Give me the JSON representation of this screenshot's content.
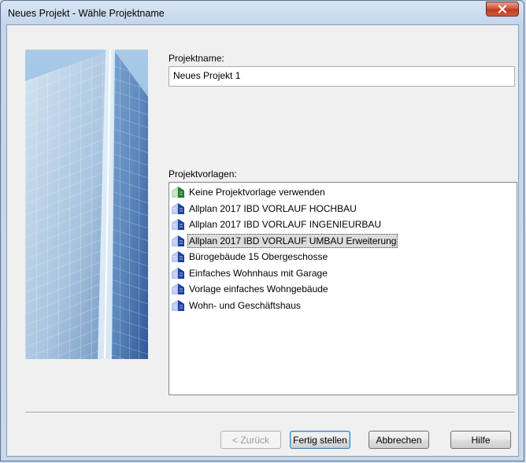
{
  "window": {
    "title": "Neues Projekt - Wähle Projektname"
  },
  "form": {
    "name_label": "Projektname:",
    "name_value": "Neues Projekt 1",
    "templates_label": "Projektvorlagen:"
  },
  "templates": [
    {
      "label": "Keine Projektvorlage verwenden",
      "icon": "green-building-icon",
      "selected": false
    },
    {
      "label": "Allplan 2017 IBD VORLAUF HOCHBAU",
      "icon": "blue-building-icon",
      "selected": false
    },
    {
      "label": "Allplan 2017 IBD VORLAUF INGENIEURBAU",
      "icon": "blue-building-icon",
      "selected": false
    },
    {
      "label": "Allplan 2017 IBD VORLAUF UMBAU Erweiterung",
      "icon": "blue-building-icon",
      "selected": true
    },
    {
      "label": "Bürogebäude 15 Obergeschosse",
      "icon": "blue-building-icon",
      "selected": false
    },
    {
      "label": "Einfaches Wohnhaus mit Garage",
      "icon": "blue-building-icon",
      "selected": false
    },
    {
      "label": "Vorlage einfaches Wohngebäude",
      "icon": "blue-building-icon",
      "selected": false
    },
    {
      "label": "Wohn- und Geschäftshaus",
      "icon": "blue-building-icon",
      "selected": false
    }
  ],
  "buttons": {
    "back": "< Zurück",
    "finish": "Fertig stellen",
    "cancel": "Abbrechen",
    "help": "Hilfe"
  },
  "colors": {
    "title_bar": "#c4d6ec",
    "close_button": "#c2381f",
    "dialog_background": "#f0f0f0",
    "selection": "#dcdcdc"
  }
}
